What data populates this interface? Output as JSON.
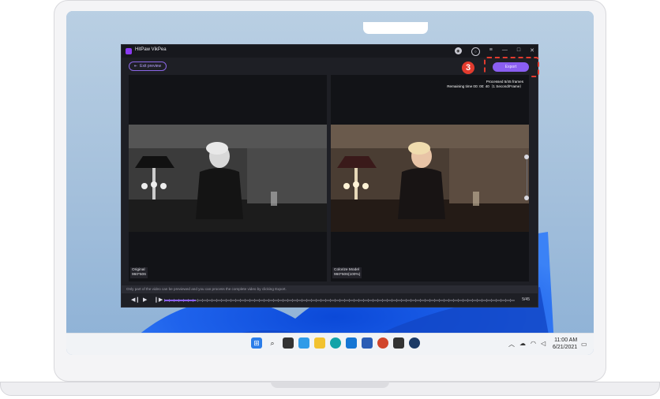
{
  "window": {
    "title": "HitPaw VikPea"
  },
  "toolbar": {
    "exit_preview": "Exit preview",
    "export": "Export",
    "step_number": "3"
  },
  "processing": {
    "processed": "Processed 5/45 frames",
    "remaining": "Remaining time 00: 00: 40（1 Second/Frame）"
  },
  "panels": {
    "original": {
      "label": "Original",
      "resolution": "960*506"
    },
    "colorized": {
      "label": "Colorize Model",
      "resolution": "960*506(100%)"
    }
  },
  "info": {
    "message": "Only part of the video can be previewed and you can process the complete video by clicking Export."
  },
  "playback": {
    "frames": "5/45",
    "progress": 0.09
  },
  "taskbar": {
    "time": "11:00 AM",
    "date": "6/21/2021"
  },
  "icons": [
    "windows-start-icon",
    "search-icon",
    "task-view-icon",
    "widgets-icon",
    "file-explorer-icon",
    "edge-icon",
    "outlook-icon",
    "word-icon",
    "powerpoint-icon",
    "store-icon",
    "steam-icon"
  ],
  "colors": {
    "accent": "#8a5ef2",
    "highlight": "#e23b2e"
  }
}
